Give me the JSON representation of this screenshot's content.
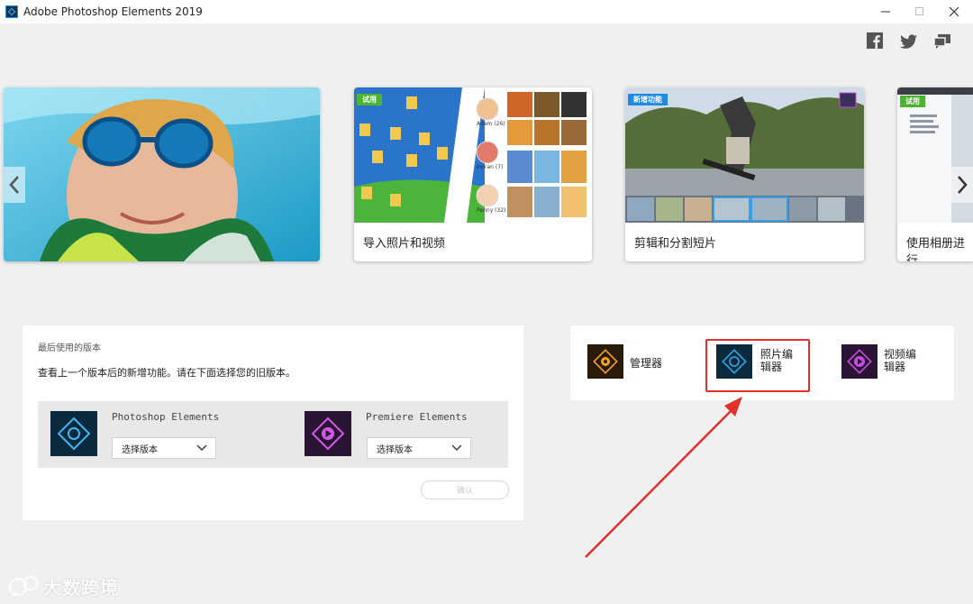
{
  "window": {
    "title": "Adobe Photoshop Elements 2019"
  },
  "colors": {
    "accent_red": "#e0312a",
    "trial_green": "#4cb431",
    "new_feature_blue": "#1f8ae0",
    "organizer_orange": "#f7a21b",
    "photo_blue": "#2ea8e8",
    "video_purple": "#c94ce0"
  },
  "social": {
    "icons": [
      "facebook-icon",
      "twitter-icon",
      "feedback-icon"
    ]
  },
  "carousel": {
    "cards": [
      {
        "label": ""
      },
      {
        "label": "导入照片和视频",
        "tag": "试用"
      },
      {
        "label": "剪辑和分割短片",
        "tag": "新增功能"
      },
      {
        "label": "使用相册进行",
        "tag": "试用"
      }
    ],
    "people": [
      "Adam (26)",
      "Keiran (7)",
      "Penny (32)"
    ]
  },
  "previous_versions": {
    "heading": "最后使用的版本",
    "description": "查看上一个版本后的新增功能。请在下面选择您的旧版本。",
    "products": [
      {
        "name": "Photoshop Elements",
        "select_placeholder": "选择版本"
      },
      {
        "name": "Premiere Elements",
        "select_placeholder": "选择版本"
      }
    ],
    "confirm_label": "确认"
  },
  "launch": {
    "organizer": "管理器",
    "photo_editor": "照片编辑器",
    "video_editor": "视频编辑器"
  },
  "watermark": {
    "text": "大数跨境"
  }
}
